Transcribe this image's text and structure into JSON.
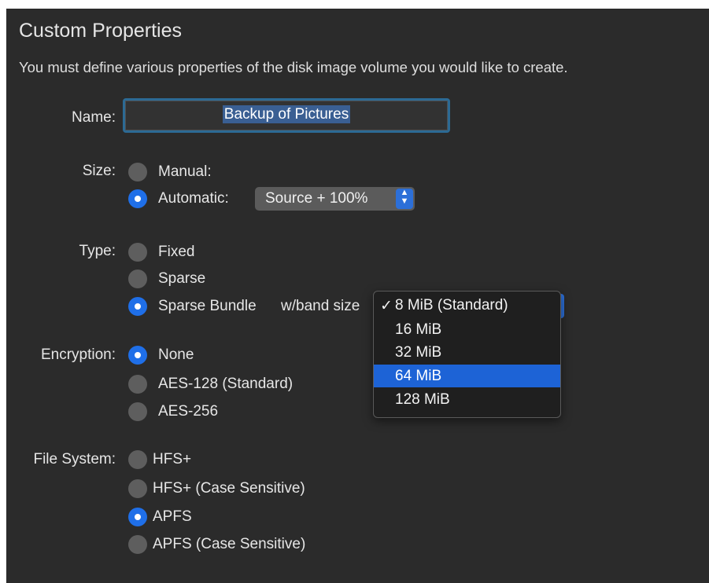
{
  "title": "Custom Properties",
  "intro": "You must define various properties of the disk image volume you would like to create.",
  "name": {
    "label": "Name:",
    "value": "Backup of Pictures"
  },
  "size": {
    "label": "Size:",
    "options": [
      {
        "label": "Manual:",
        "selected": false
      },
      {
        "label": "Automatic:",
        "selected": true
      }
    ],
    "automatic_select": "Source + 100%"
  },
  "type": {
    "label": "Type:",
    "options": [
      {
        "label": "Fixed",
        "selected": false
      },
      {
        "label": "Sparse",
        "selected": false
      },
      {
        "label": "Sparse Bundle",
        "selected": true
      }
    ],
    "band_size_label": "w/band size"
  },
  "band_size_menu": {
    "items": [
      {
        "label": "8 MiB (Standard)",
        "checked": true,
        "highlighted": false
      },
      {
        "label": "16 MiB",
        "checked": false,
        "highlighted": false
      },
      {
        "label": "32 MiB",
        "checked": false,
        "highlighted": false
      },
      {
        "label": "64 MiB",
        "checked": false,
        "highlighted": true
      },
      {
        "label": "128 MiB",
        "checked": false,
        "highlighted": false
      }
    ],
    "check_glyph": "✓"
  },
  "encryption": {
    "label": "Encryption:",
    "options": [
      {
        "label": "None",
        "selected": true
      },
      {
        "label": "AES-128 (Standard)",
        "selected": false
      },
      {
        "label": "AES-256",
        "selected": false
      }
    ]
  },
  "file_system": {
    "label": "File System:",
    "options": [
      {
        "label": "HFS+",
        "selected": false
      },
      {
        "label": "HFS+ (Case Sensitive)",
        "selected": false
      },
      {
        "label": "APFS",
        "selected": true
      },
      {
        "label": "APFS (Case Sensitive)",
        "selected": false
      }
    ]
  },
  "colors": {
    "background": "#2b2b2b",
    "accent": "#1f6fe8",
    "menu_highlight": "#1d63d6",
    "focus_ring": "#2c6a94"
  }
}
